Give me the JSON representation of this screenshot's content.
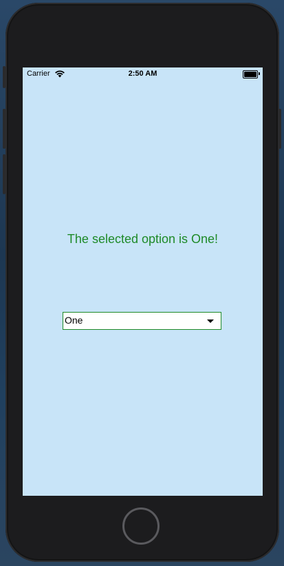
{
  "status_bar": {
    "carrier": "Carrier",
    "time": "2:50 AM",
    "wifi_icon": "wifi-icon",
    "battery_icon": "battery-icon",
    "battery_level": 1.0
  },
  "main": {
    "selected_message": "The selected option is One!",
    "dropdown": {
      "selected_value": "One",
      "arrow_icon": "caret-down-icon"
    }
  },
  "colors": {
    "screen_background": "#c8e4f8",
    "accent_green": "#1e8a28",
    "device_body": "#1c1c1e"
  }
}
